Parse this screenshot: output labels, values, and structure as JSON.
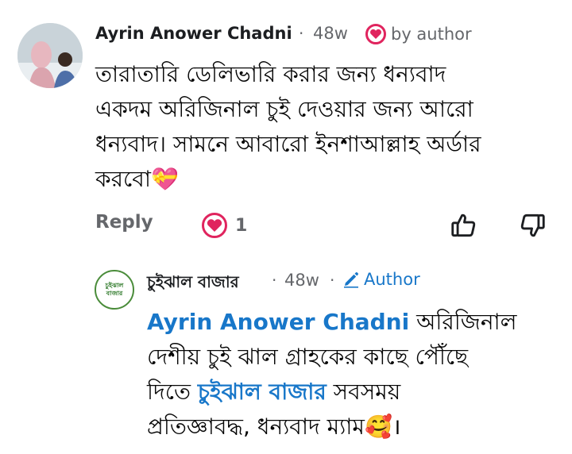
{
  "comment": {
    "author": "Ayrin Anower Chadni",
    "time": "48w",
    "badge_label": "by author",
    "lines": [
      "তারাতারি ডেলিভারি করার জন্য ধন্যবাদ",
      "একদম অরিজিনাল চুই দেওয়ার জন্য আরো",
      "ধন্যবাদ। সামনে আবারো ইনশাআল্লাহ অর্ডার",
      "করবো"
    ],
    "emoji": "💝",
    "reply_label": "Reply",
    "reaction_count": "1"
  },
  "reply": {
    "author": "চুইঝাল বাজার",
    "time": "48w",
    "author_badge": "Author",
    "avatar_text": "চুইঝাল বাজার",
    "mention": "Ayrin Anower Chadni",
    "text_part1": " অরিজিনাল",
    "line2": "দেশীয় চুই ঝাল গ্রাহকের কাছে পৌঁছে",
    "line3_start": "দিতে ",
    "mention2": "চুইঝাল বাজার",
    "line3_end": " সবসময়",
    "line4": "প্রতিজ্ঞাবদ্ধ, ধন্যবাদ ম্যাম",
    "emoji": "🥰",
    "line4_end": "।"
  }
}
